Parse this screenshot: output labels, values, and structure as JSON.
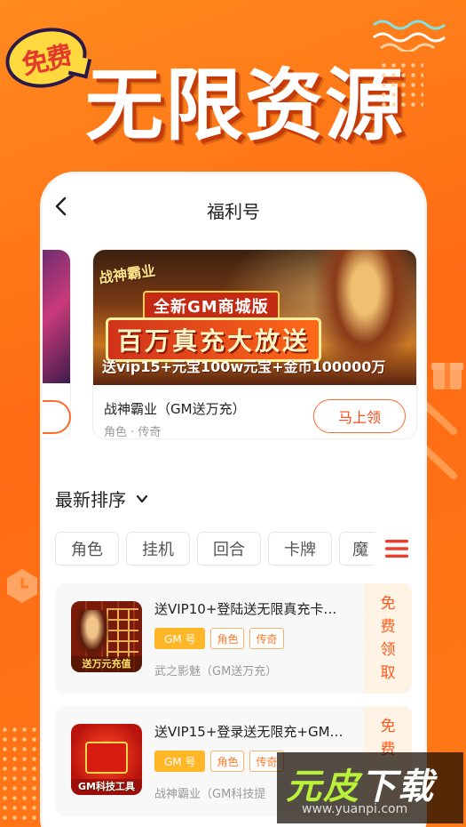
{
  "promo": {
    "badge": "免费",
    "headline": "无限资源"
  },
  "nav": {
    "title": "福利号"
  },
  "banner": {
    "logo_text": "战神霸业",
    "subtitle": "全新GM商城版",
    "big_text": "百万真充大放送",
    "detail_line": "送vip15+元宝100w元宝+金币100000万",
    "game_title": "战神霸业（GM送万充）",
    "tags": "角色 · 传奇",
    "cta_label": "马上领"
  },
  "sort": {
    "label": "最新排序"
  },
  "categories": [
    "角色",
    "挂机",
    "回合",
    "卡牌",
    "魔"
  ],
  "items": [
    {
      "title": "送VIP10+登陆送无限真充卡…",
      "chips": [
        "GM 号",
        "角色",
        "传奇"
      ],
      "subtitle": "武之影魅（GM送万充）",
      "thumb_caption": "送万元充值",
      "free_label": [
        "免",
        "费",
        "领",
        "取"
      ]
    },
    {
      "title": "送VIP15+登录送无限充+GM…",
      "chips": [
        "GM 号",
        "角色",
        "传奇"
      ],
      "subtitle": "战神霸业（GM科技提",
      "thumb_caption": "GM科技工具",
      "free_label": [
        "免",
        "费"
      ]
    }
  ],
  "watermark": {
    "main_a": "元皮",
    "main_b": "下载",
    "url": "www.yuanpi.com"
  },
  "colors": {
    "accent": "#ff6a14",
    "cta": "#ff4a1a",
    "gm_chip": "#ffb627"
  }
}
